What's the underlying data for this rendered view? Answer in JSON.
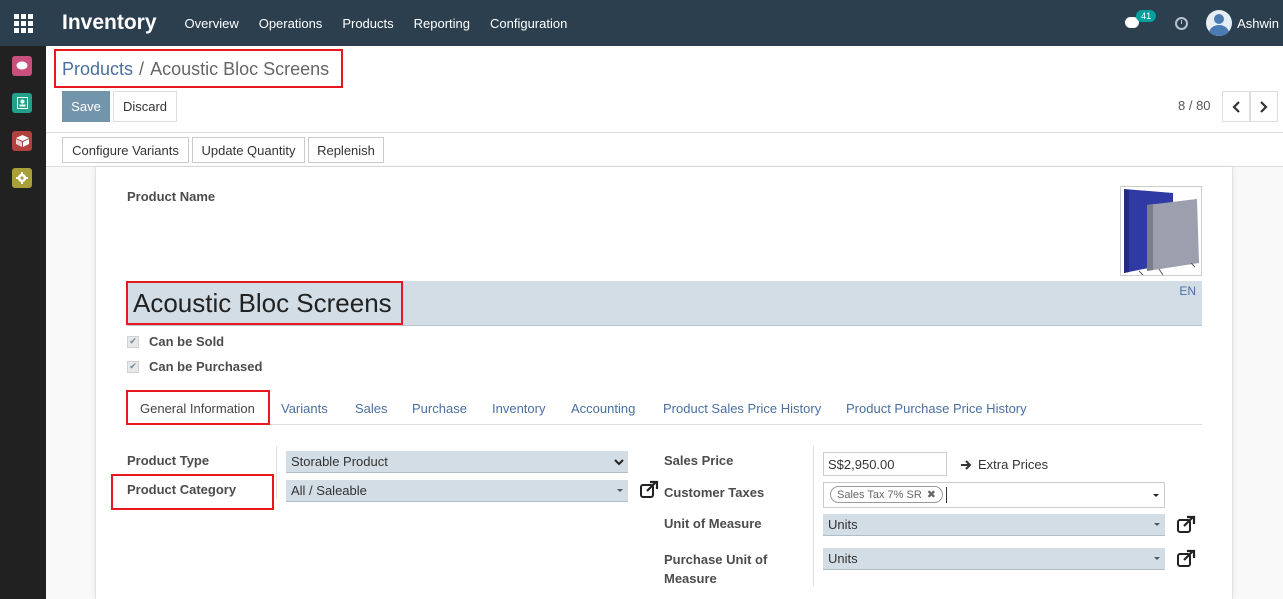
{
  "topbar": {
    "app_title": "Inventory",
    "menu": [
      "Overview",
      "Operations",
      "Products",
      "Reporting",
      "Configuration"
    ],
    "chat_count": "41",
    "user_name": "Ashwin"
  },
  "sidebar": {
    "apps": [
      {
        "icon": "discuss-icon",
        "color": "#c94f7c"
      },
      {
        "icon": "contacts-icon",
        "color": "#22a08a"
      },
      {
        "icon": "inventory-icon",
        "color": "#b0413e"
      },
      {
        "icon": "settings-icon",
        "color": "#a9a03a"
      }
    ]
  },
  "breadcrumb": {
    "parent": "Products",
    "separator": "/",
    "current": "Acoustic Bloc Screens"
  },
  "actions": {
    "save_label": "Save",
    "discard_label": "Discard"
  },
  "pager": {
    "value": "8 / 80"
  },
  "statusbar": {
    "buttons": [
      "Configure Variants",
      "Update Quantity",
      "Replenish"
    ]
  },
  "form": {
    "product_name_label": "Product Name",
    "product_name": "Acoustic Bloc Screens",
    "lang": "EN",
    "can_be_sold_label": "Can be Sold",
    "can_be_purchased_label": "Can be Purchased",
    "tabs": [
      "General Information",
      "Variants",
      "Sales",
      "Purchase",
      "Inventory",
      "Accounting",
      "Product Sales Price History",
      "Product Purchase Price History"
    ],
    "product_type_label": "Product Type",
    "product_type": "Storable Product",
    "product_category_label": "Product Category",
    "product_category": "All / Saleable",
    "sales_price_label": "Sales Price",
    "sales_price": "S$2,950.00",
    "extra_prices_label": "Extra Prices",
    "customer_taxes_label": "Customer Taxes",
    "customer_tax_tag": "Sales Tax 7% SR",
    "uom_label": "Unit of Measure",
    "uom": "Units",
    "purchase_uom_label_1": "Purchase Unit of",
    "purchase_uom_label_2": "Measure",
    "purchase_uom": "Units"
  },
  "colors": {
    "topbar": "#2c3f4f",
    "primary": "#7295ac",
    "link": "#4a6fa0",
    "field_bg": "#d2dde5",
    "highlight": "#e8171f"
  }
}
